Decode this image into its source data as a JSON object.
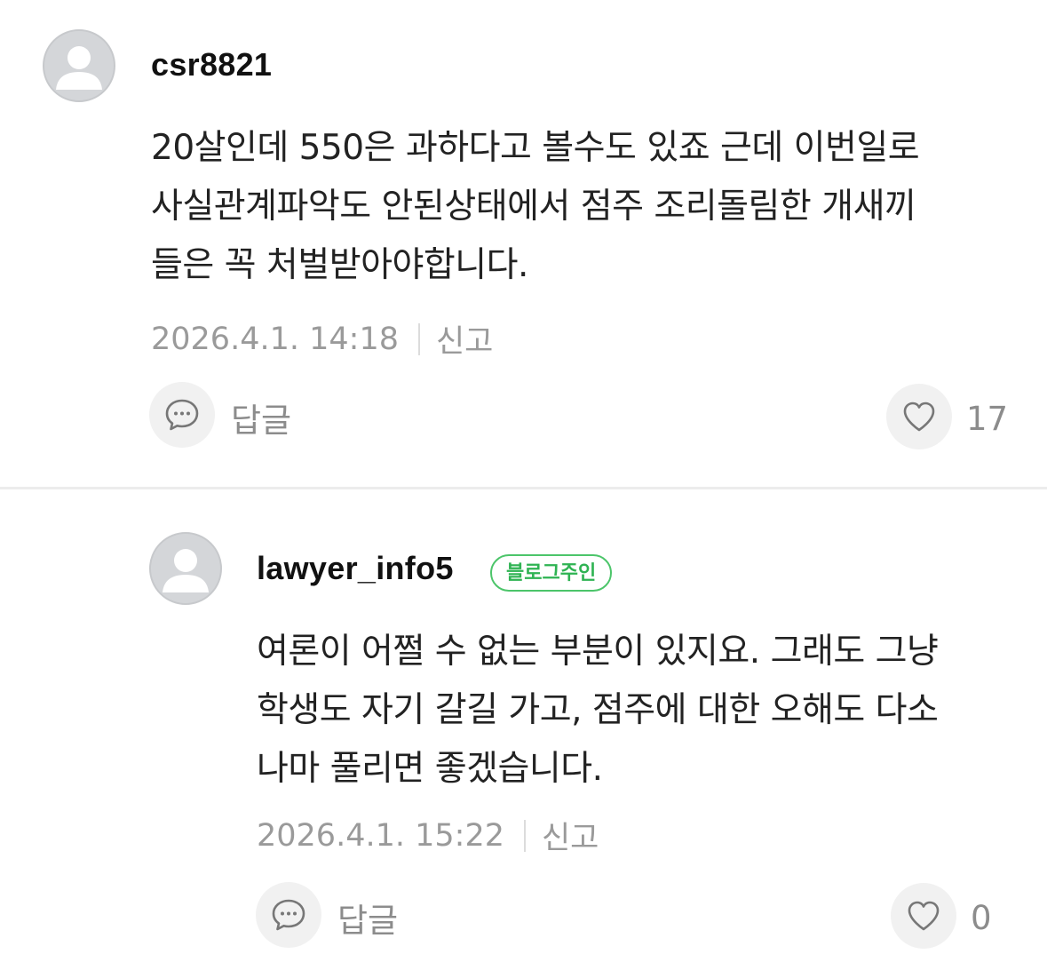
{
  "comments": [
    {
      "username": "csr8821",
      "badge": "",
      "text": "20살인데 550은 과하다고 볼수도 있죠 근데 이번일로\n사실관계파악도 안된상태에서 점주 조리돌림한 개새끼\n들은 꼭 처벌받아야합니다.",
      "timestamp": "2026.4.1. 14:18",
      "report_label": "신고",
      "reply_label": "답글",
      "like_count": "17"
    },
    {
      "username": "lawyer_info5",
      "badge": "블로그주인",
      "text": "여론이 어쩔 수 없는 부분이 있지요. 그래도 그냥\n학생도 자기 갈길 가고, 점주에 대한 오해도 다소\n나마 풀리면 좋겠습니다.",
      "timestamp": "2026.4.1. 15:22",
      "report_label": "신고",
      "reply_label": "답글",
      "like_count": "0"
    }
  ],
  "colors": {
    "badge_green": "#2fb353",
    "meta_gray": "#9a9a9a",
    "divider": "#ececec"
  },
  "icons": {
    "avatar": "default-profile-icon",
    "reply": "speech-bubble-icon",
    "like": "heart-icon"
  }
}
